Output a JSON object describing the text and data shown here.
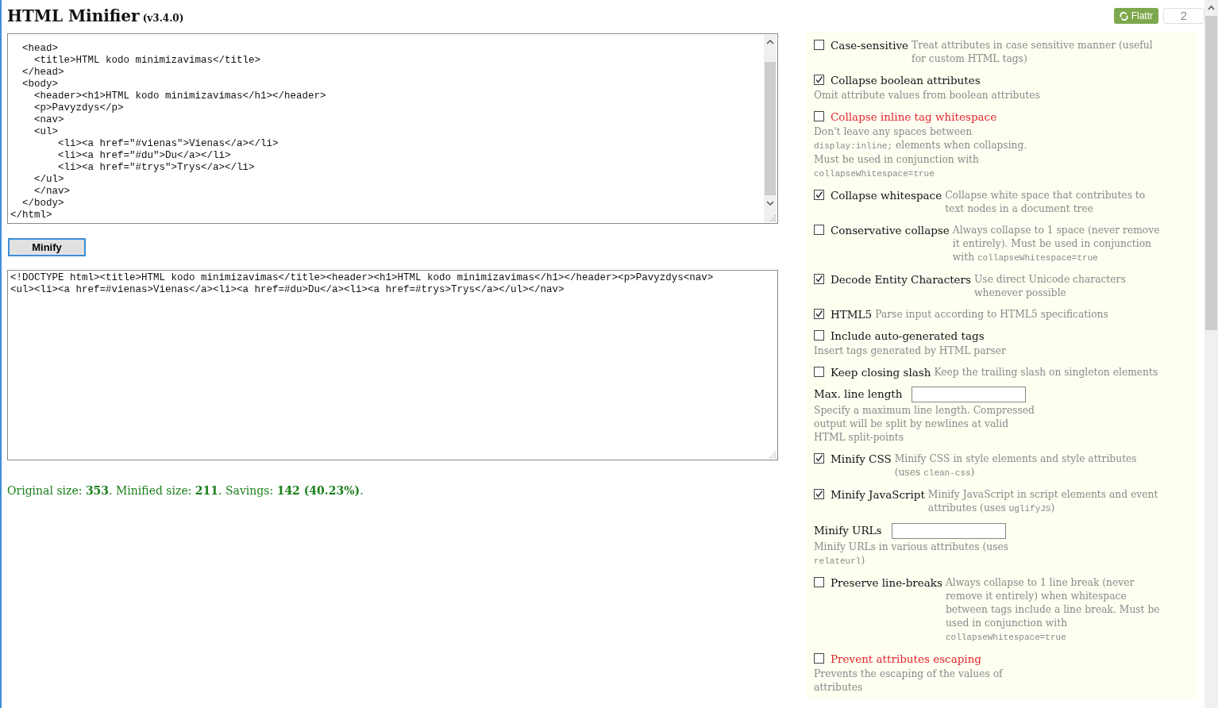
{
  "header": {
    "title": "HTML Minifier",
    "version": "(v3.4.0)"
  },
  "flattr": {
    "label": "Flattr",
    "count": "2"
  },
  "input": {
    "lines": [
      "  <head>",
      "    <title>HTML kodo minimizavimas</title>",
      "  </head>",
      "  <body>",
      "    <header><h1>HTML kodo minimizavimas</h1></header>",
      "    <p>Pavyzdys</p>",
      "    <nav>",
      "    <ul>",
      "        <li><a href=\"#vienas\">Vienas</a></li>",
      "        <li><a href=\"#du\">Du</a></li>",
      "        <li><a href=\"#trys\">Trys</a></li>",
      "    </ul>",
      "    </nav>",
      "  </body>",
      "</html>"
    ]
  },
  "minify_button": "Minify",
  "output": {
    "lines": [
      "<!DOCTYPE html><title>HTML kodo minimizavimas</title><header><h1>HTML kodo minimizavimas</h1></header><p>Pavyzdys<nav>",
      "<ul><li><a href=#vienas>Vienas</a><li><a href=#du>Du</a><li><a href=#trys>Trys</a></ul></nav>"
    ]
  },
  "stats": "Original size: **353**. Minified size: **211**. Savings: **142 (40.23%)**.",
  "options": [
    {
      "kind": "checkbox",
      "label": "Case-sensitive",
      "checked": false,
      "inline_description": true,
      "description": [
        {
          "kind": "text",
          "text": "Treat attributes in case sensitive manner (useful for custom HTML tags)"
        }
      ]
    },
    {
      "kind": "checkbox",
      "label": "Collapse boolean attributes",
      "checked": true,
      "inline_description": false,
      "description": [
        {
          "kind": "text",
          "text": "Omit attribute values from boolean attributes"
        }
      ]
    },
    {
      "kind": "checkbox",
      "label": "Collapse inline tag whitespace",
      "checked": false,
      "inline_description": false,
      "color": "#e0262b",
      "description": [
        {
          "kind": "text",
          "text": "Don't leave any spaces between "
        },
        {
          "kind": "code",
          "text": "display:inline;"
        },
        {
          "kind": "text",
          "text": " elements when collapsing. Must be used in conjunction with "
        },
        {
          "kind": "code",
          "text": "collapseWhitespace=true"
        }
      ]
    },
    {
      "kind": "checkbox",
      "label": "Collapse whitespace",
      "checked": true,
      "inline_description": true,
      "description": [
        {
          "kind": "text",
          "text": "Collapse white space that contributes to text nodes in a document tree"
        }
      ]
    },
    {
      "kind": "checkbox",
      "label": "Conservative collapse",
      "checked": false,
      "inline_description": true,
      "description": [
        {
          "kind": "text",
          "text": "Always collapse to 1 space (never remove it entirely). Must be used in conjunction with "
        },
        {
          "kind": "code",
          "text": "collapseWhitespace=true"
        }
      ]
    },
    {
      "kind": "checkbox",
      "label": "Decode Entity Characters",
      "checked": true,
      "inline_description": true,
      "description": [
        {
          "kind": "text",
          "text": "Use direct Unicode characters whenever possible"
        }
      ]
    },
    {
      "kind": "checkbox",
      "label": "HTML5",
      "checked": true,
      "inline_description": true,
      "description": [
        {
          "kind": "text",
          "text": "Parse input according to HTML5 specifications"
        }
      ]
    },
    {
      "kind": "checkbox",
      "label": "Include auto-generated tags",
      "checked": false,
      "inline_description": false,
      "description": [
        {
          "kind": "text",
          "text": "Insert tags generated by HTML parser"
        }
      ]
    },
    {
      "kind": "checkbox",
      "label": "Keep closing slash",
      "checked": false,
      "inline_description": true,
      "description": [
        {
          "kind": "text",
          "text": "Keep the trailing slash on singleton elements"
        }
      ]
    },
    {
      "kind": "input",
      "label": "Max. line length",
      "inline_description": false,
      "description": [
        {
          "kind": "text",
          "text": "Specify a maximum line length. Compressed output will be split by newlines at valid HTML split-points"
        }
      ]
    },
    {
      "kind": "checkbox",
      "label": "Minify CSS",
      "checked": true,
      "inline_description": true,
      "description": [
        {
          "kind": "text",
          "text": "Minify CSS in style elements and style attributes (uses "
        },
        {
          "kind": "code",
          "text": "clean-css"
        },
        {
          "kind": "text",
          "text": ")"
        }
      ]
    },
    {
      "kind": "checkbox",
      "label": "Minify JavaScript",
      "checked": true,
      "inline_description": true,
      "description": [
        {
          "kind": "text",
          "text": "Minify JavaScript in script elements and event attributes (uses "
        },
        {
          "kind": "code",
          "text": "UglifyJS"
        },
        {
          "kind": "text",
          "text": ")"
        }
      ]
    },
    {
      "kind": "input",
      "label": "Minify URLs",
      "inline_description": false,
      "description": [
        {
          "kind": "text",
          "text": "Minify URLs in various attributes (uses "
        },
        {
          "kind": "code",
          "text": "relateurl"
        },
        {
          "kind": "text",
          "text": ")"
        }
      ]
    },
    {
      "kind": "checkbox",
      "label": "Preserve line-breaks",
      "checked": false,
      "inline_description": true,
      "description": [
        {
          "kind": "text",
          "text": "Always collapse to 1 line break (never remove it entirely) when whitespace between tags include a line break. Must be used in conjunction with "
        },
        {
          "kind": "code",
          "text": "collapseWhitespace=true"
        }
      ]
    },
    {
      "kind": "checkbox",
      "label": "Prevent attributes escaping",
      "checked": false,
      "inline_description": false,
      "color": "#e0262b",
      "description": [
        {
          "kind": "text",
          "text": "Prevents the escaping of the values of attributes"
        }
      ]
    }
  ]
}
